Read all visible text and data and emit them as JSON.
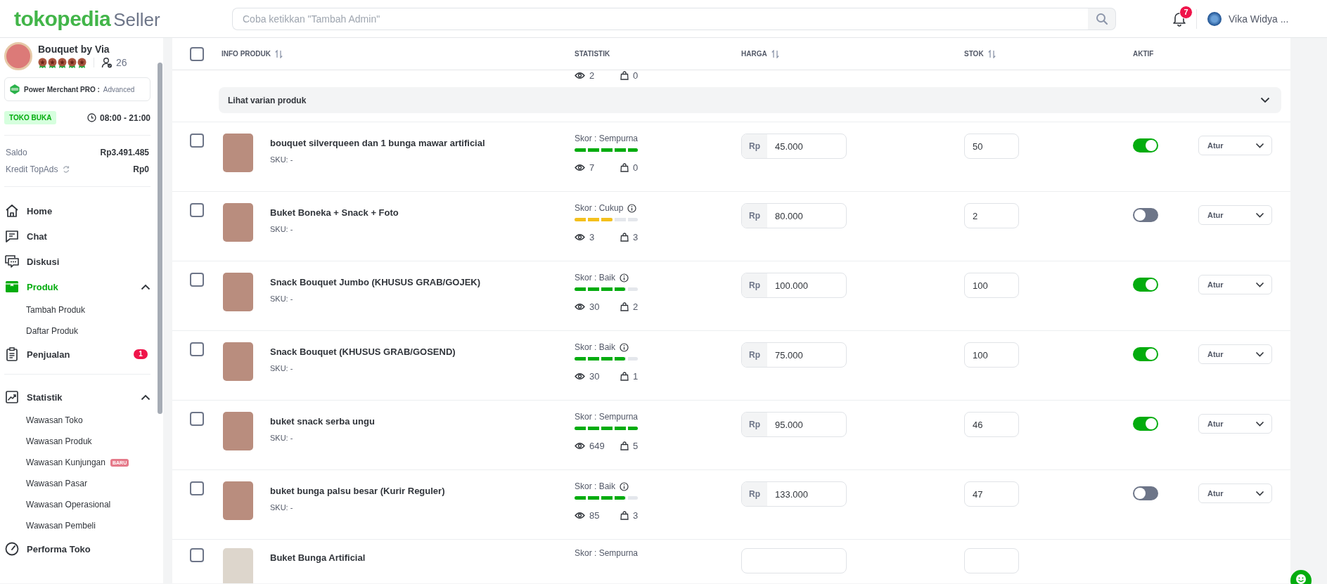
{
  "header": {
    "logo_brand": "tokopedia",
    "logo_suffix": "Seller",
    "search": {
      "placeholder": "Coba ketikkan \"Tambah Admin\""
    },
    "notification_count": "7",
    "user_name": "Vika Widya ..."
  },
  "sidebar": {
    "shop": {
      "name": "Bouquet by Via",
      "followers": "26"
    },
    "merchant": {
      "plan": "Power Merchant PRO :",
      "grade": "Advanced"
    },
    "status": "TOKO BUKA",
    "hours": "08:00 - 21:00",
    "balances": [
      {
        "label": "Saldo",
        "value": "Rp3.491.485",
        "has_refresh": false
      },
      {
        "label": "Kredit TopAds",
        "value": "Rp0",
        "has_refresh": true
      }
    ],
    "sections": [
      {
        "items": [
          {
            "label": "Home",
            "selected": false
          },
          {
            "label": "Chat",
            "selected": false
          },
          {
            "label": "Diskusi",
            "selected": false
          },
          {
            "label": "Produk",
            "selected": true,
            "expanded": true,
            "children": [
              {
                "label": "Tambah Produk"
              },
              {
                "label": "Daftar Produk"
              }
            ]
          },
          {
            "label": "Penjualan",
            "selected": false,
            "badge": "1"
          }
        ]
      },
      {
        "items": [
          {
            "label": "Statistik",
            "selected": false,
            "expanded": true,
            "children": [
              {
                "label": "Wawasan Toko"
              },
              {
                "label": "Wawasan Produk"
              },
              {
                "label": "Wawasan Kunjungan",
                "badge": "BARU"
              },
              {
                "label": "Wawasan Pasar"
              },
              {
                "label": "Wawasan Operasional"
              },
              {
                "label": "Wawasan Pembeli"
              }
            ]
          },
          {
            "label": "Performa Toko",
            "selected": false
          }
        ]
      }
    ]
  },
  "table": {
    "select_all_checked": false,
    "columns": [
      {
        "label": "INFO PRODUK",
        "sortable": true
      },
      {
        "label": "STATISTIK",
        "sortable": false
      },
      {
        "label": "HARGA",
        "sortable": true
      },
      {
        "label": "STOK",
        "sortable": true
      },
      {
        "label": "AKTIF",
        "sortable": false
      }
    ],
    "partial_row": {
      "views": "2",
      "sold": "0"
    },
    "variant_link": "Lihat varian produk",
    "rows": [
      {
        "checked": false,
        "name": "bouquet silverqueen dan 1 bunga mawar artificial",
        "sku": "SKU: -",
        "score": {
          "text": "Skor : Sempurna",
          "info": false,
          "level": 1,
          "color": "#03ac0e"
        },
        "views": "7",
        "sold": "0",
        "currency": "Rp",
        "price": "45.000",
        "stock": "50",
        "active": true,
        "action": "Atur"
      },
      {
        "checked": false,
        "name": "Buket Boneka + Snack + Foto",
        "sku": "SKU: -",
        "score": {
          "text": "Skor : Cukup",
          "info": true,
          "level": 0.6,
          "color": "#f4c01c"
        },
        "views": "3",
        "sold": "3",
        "currency": "Rp",
        "price": "80.000",
        "stock": "2",
        "active": false,
        "action": "Atur"
      },
      {
        "checked": false,
        "name": "Snack Bouquet Jumbo (KHUSUS GRAB/GOJEK)",
        "sku": "SKU: -",
        "score": {
          "text": "Skor : Baik",
          "info": true,
          "level": 0.8,
          "color": "#03ac0e"
        },
        "views": "30",
        "sold": "2",
        "currency": "Rp",
        "price": "100.000",
        "stock": "100",
        "active": true,
        "action": "Atur"
      },
      {
        "checked": false,
        "name": "Snack Bouquet (KHUSUS GRAB/GOSEND)",
        "sku": "SKU: -",
        "score": {
          "text": "Skor : Baik",
          "info": true,
          "level": 0.8,
          "color": "#03ac0e"
        },
        "views": "30",
        "sold": "1",
        "currency": "Rp",
        "price": "75.000",
        "stock": "100",
        "active": true,
        "action": "Atur"
      },
      {
        "checked": false,
        "name": "buket snack serba ungu",
        "sku": "SKU: -",
        "score": {
          "text": "Skor : Sempurna",
          "info": false,
          "level": 1,
          "color": "#03ac0e"
        },
        "views": "649",
        "sold": "5",
        "currency": "Rp",
        "price": "95.000",
        "stock": "46",
        "active": true,
        "action": "Atur"
      },
      {
        "checked": false,
        "name": "buket bunga palsu besar (Kurir Reguler)",
        "sku": "SKU: -",
        "score": {
          "text": "Skor : Baik",
          "info": true,
          "level": 0.8,
          "color": "#03ac0e"
        },
        "views": "85",
        "sold": "3",
        "currency": "Rp",
        "price": "133.000",
        "stock": "47",
        "active": false,
        "action": "Atur"
      }
    ],
    "cut_row": {
      "checked": false,
      "name": "Buket Bunga Artificial",
      "score_text": "Skor : Sempurna"
    }
  }
}
